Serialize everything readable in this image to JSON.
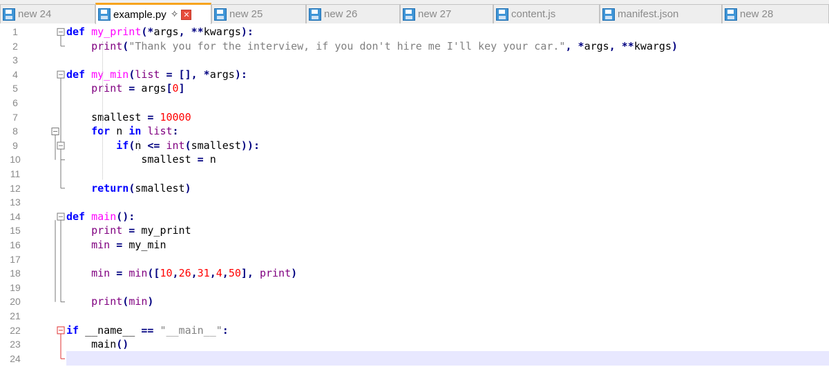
{
  "tabs": [
    {
      "label": "new 24",
      "active": false
    },
    {
      "label": "example.py",
      "active": true,
      "pin_icon": "pin-icon",
      "close_icon": "close-icon"
    },
    {
      "label": "new 25",
      "active": false
    },
    {
      "label": "new 26",
      "active": false
    },
    {
      "label": "new 27",
      "active": false
    },
    {
      "label": "content.js",
      "active": false
    },
    {
      "label": "manifest.json",
      "active": false
    },
    {
      "label": "new 28",
      "active": false
    }
  ],
  "editor": {
    "current_line": 24,
    "colors": {
      "keyword": "#0000ff",
      "function_name": "#ff00ff",
      "string": "#808080",
      "number": "#ff0000",
      "operator": "#000080",
      "builtin": "#800080",
      "current_line_bg": "#e8e8ff"
    },
    "lines": [
      [
        [
          "kw",
          "def"
        ],
        [
          "id",
          " "
        ],
        [
          "fn",
          "my_print"
        ],
        [
          "op",
          "(*"
        ],
        [
          "id",
          "args"
        ],
        [
          "op",
          ", **"
        ],
        [
          "id",
          "kwargs"
        ],
        [
          "op",
          "):"
        ]
      ],
      [
        [
          "id",
          "    "
        ],
        [
          "bi",
          "print"
        ],
        [
          "op",
          "("
        ],
        [
          "str",
          "\"Thank you for the interview, if you don't hire me I'll key your car.\""
        ],
        [
          "op",
          ", *"
        ],
        [
          "id",
          "args"
        ],
        [
          "op",
          ", **"
        ],
        [
          "id",
          "kwargs"
        ],
        [
          "op",
          ")"
        ]
      ],
      [],
      [
        [
          "kw",
          "def"
        ],
        [
          "id",
          " "
        ],
        [
          "fn",
          "my_min"
        ],
        [
          "op",
          "("
        ],
        [
          "bi",
          "list"
        ],
        [
          "op",
          " = [], *"
        ],
        [
          "id",
          "args"
        ],
        [
          "op",
          "):"
        ]
      ],
      [
        [
          "id",
          "    "
        ],
        [
          "bi",
          "print"
        ],
        [
          "op",
          " = "
        ],
        [
          "id",
          "args"
        ],
        [
          "op",
          "["
        ],
        [
          "num",
          "0"
        ],
        [
          "op",
          "]"
        ]
      ],
      [],
      [
        [
          "id",
          "    smallest "
        ],
        [
          "op",
          "= "
        ],
        [
          "num",
          "10000"
        ]
      ],
      [
        [
          "id",
          "    "
        ],
        [
          "kw",
          "for"
        ],
        [
          "id",
          " n "
        ],
        [
          "kw",
          "in"
        ],
        [
          "id",
          " "
        ],
        [
          "bi",
          "list"
        ],
        [
          "op",
          ":"
        ]
      ],
      [
        [
          "id",
          "        "
        ],
        [
          "kw",
          "if"
        ],
        [
          "op",
          "("
        ],
        [
          "id",
          "n "
        ],
        [
          "op",
          "<= "
        ],
        [
          "bi",
          "int"
        ],
        [
          "op",
          "("
        ],
        [
          "id",
          "smallest"
        ],
        [
          "op",
          "))"
        ],
        [
          "op",
          ":"
        ]
      ],
      [
        [
          "id",
          "            smallest "
        ],
        [
          "op",
          "= "
        ],
        [
          "id",
          "n"
        ]
      ],
      [],
      [
        [
          "id",
          "    "
        ],
        [
          "kw",
          "return"
        ],
        [
          "op",
          "("
        ],
        [
          "id",
          "smallest"
        ],
        [
          "op",
          ")"
        ]
      ],
      [],
      [
        [
          "kw",
          "def"
        ],
        [
          "id",
          " "
        ],
        [
          "fn",
          "main"
        ],
        [
          "op",
          "():"
        ]
      ],
      [
        [
          "id",
          "    "
        ],
        [
          "bi",
          "print"
        ],
        [
          "op",
          " = "
        ],
        [
          "id",
          "my_print"
        ]
      ],
      [
        [
          "id",
          "    "
        ],
        [
          "bi",
          "min"
        ],
        [
          "op",
          " = "
        ],
        [
          "id",
          "my_min"
        ]
      ],
      [],
      [
        [
          "id",
          "    "
        ],
        [
          "bi",
          "min"
        ],
        [
          "op",
          " = "
        ],
        [
          "bi",
          "min"
        ],
        [
          "op",
          "(["
        ],
        [
          "num",
          "10"
        ],
        [
          "op",
          ","
        ],
        [
          "num",
          "26"
        ],
        [
          "op",
          ","
        ],
        [
          "num",
          "31"
        ],
        [
          "op",
          ","
        ],
        [
          "num",
          "4"
        ],
        [
          "op",
          ","
        ],
        [
          "num",
          "50"
        ],
        [
          "op",
          "], "
        ],
        [
          "bi",
          "print"
        ],
        [
          "op",
          ")"
        ]
      ],
      [],
      [
        [
          "id",
          "    "
        ],
        [
          "bi",
          "print"
        ],
        [
          "op",
          "("
        ],
        [
          "bi",
          "min"
        ],
        [
          "op",
          ")"
        ]
      ],
      [],
      [
        [
          "kw",
          "if"
        ],
        [
          "id",
          " __name__ "
        ],
        [
          "op",
          "=="
        ],
        [
          "id",
          " "
        ],
        [
          "str",
          "\"__main__\""
        ],
        [
          "op",
          ":"
        ]
      ],
      [
        [
          "id",
          "    main"
        ],
        [
          "op",
          "()"
        ]
      ],
      []
    ]
  }
}
